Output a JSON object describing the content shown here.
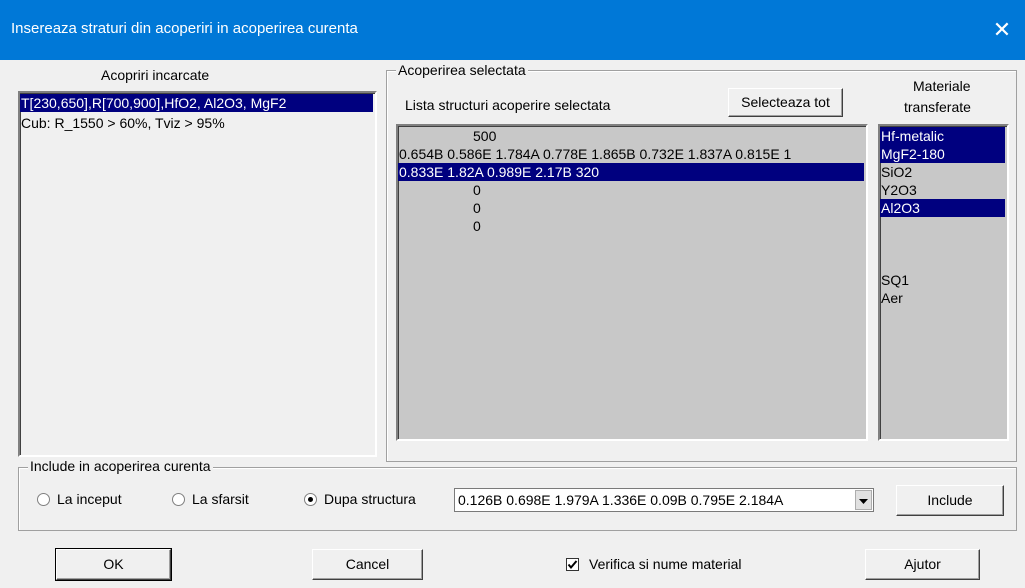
{
  "window": {
    "title": "Insereaza straturi din acoperiri in acoperirea curenta",
    "close_glyph": "✕"
  },
  "left_panel": {
    "label": "Acopriri incarcate",
    "items": [
      {
        "text": "T[230,650],R[700,900],HfO2, Al2O3, MgF2",
        "selected": true
      },
      {
        "text": "Cub: R_1550 > 60%, Tviz > 95%",
        "selected": false
      }
    ]
  },
  "selected_group": {
    "title": "Acoperirea selectata",
    "list_label": "Lista structuri acoperire selectata",
    "select_all_label": "Selecteaza tot",
    "structures": [
      {
        "text": "500",
        "selected": false,
        "indent": true
      },
      {
        "text": "0.654B 0.586E 1.784A 0.778E 1.865B 0.732E 1.837A 0.815E 1",
        "selected": false,
        "indent": false
      },
      {
        "text": "0.833E 1.82A 0.989E 2.17B  320",
        "selected": true,
        "indent": false
      },
      {
        "text": "0",
        "selected": false,
        "indent": true
      },
      {
        "text": "0",
        "selected": false,
        "indent": true
      },
      {
        "text": "0",
        "selected": false,
        "indent": true
      }
    ]
  },
  "materials": {
    "label_line1": "Materiale",
    "label_line2": "transferate",
    "items": [
      {
        "text": "Hf-metalic",
        "selected": true
      },
      {
        "text": "MgF2-180",
        "selected": true
      },
      {
        "text": "SiO2",
        "selected": false
      },
      {
        "text": "Y2O3",
        "selected": false
      },
      {
        "text": "Al2O3",
        "selected": true
      },
      {
        "text": "",
        "selected": false
      },
      {
        "text": "",
        "selected": false
      },
      {
        "text": "",
        "selected": false
      },
      {
        "text": "SQ1",
        "selected": false
      },
      {
        "text": "Aer",
        "selected": false
      }
    ]
  },
  "include_group": {
    "title": "Include in acoperirea curenta",
    "radios": [
      {
        "label": "La inceput",
        "checked": false
      },
      {
        "label": "La sfarsit",
        "checked": false
      },
      {
        "label": "Dupa structura",
        "checked": true
      }
    ],
    "combo_value": "0.126B 0.698E 1.979A 1.336E 0.09B 0.795E 2.184A",
    "include_label": "Include"
  },
  "footer": {
    "ok_label": "OK",
    "cancel_label": "Cancel",
    "verify_label": "Verifica si nume material",
    "verify_checked": true,
    "help_label": "Ajutor"
  },
  "colors": {
    "titlebar": "#0078d7",
    "selection": "#00007f",
    "list_gray": "#c8c8c8"
  }
}
